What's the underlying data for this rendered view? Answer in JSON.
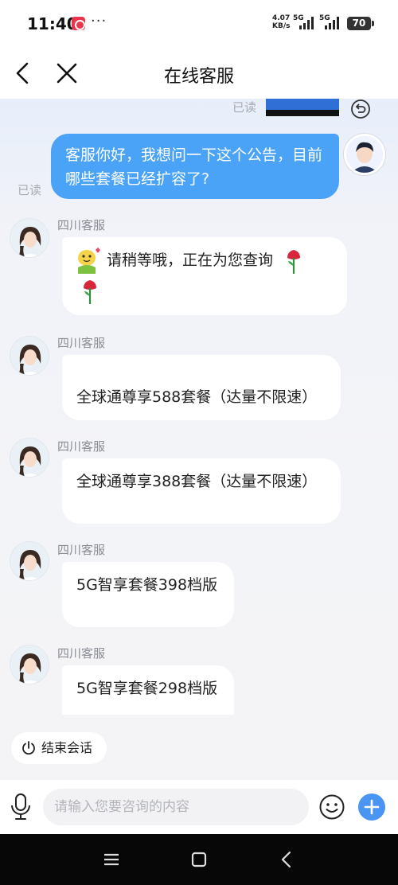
{
  "status_bar": {
    "time": "11:40",
    "more": "···",
    "net_speed_value": "4.07",
    "net_speed_unit": "KB/s",
    "signal1_label": "5G",
    "signal2_label": "5G",
    "battery": "70"
  },
  "nav": {
    "title": "在线客服",
    "back_icon": "back-arrow-icon",
    "close_icon": "close-icon"
  },
  "chat": {
    "read_label": "已读",
    "user_message": "客服你好，我想问一下这个公告，目前哪些套餐已经扩容了?",
    "agent_name": "四川客服",
    "agent_messages": [
      "请稍等哦，正在为您查询",
      "全球通尊享588套餐（达量不限速）",
      "全球通尊享388套餐（达量不限速）",
      "5G智享套餐398档版",
      "5G智享套餐298档版"
    ]
  },
  "end_chat_label": "结束会话",
  "input": {
    "placeholder": "请输入您要咨询的内容",
    "value": ""
  },
  "colors": {
    "accent": "#4aa3f6",
    "plus_button": "#4a94f2",
    "background": "#f4f4f6"
  }
}
